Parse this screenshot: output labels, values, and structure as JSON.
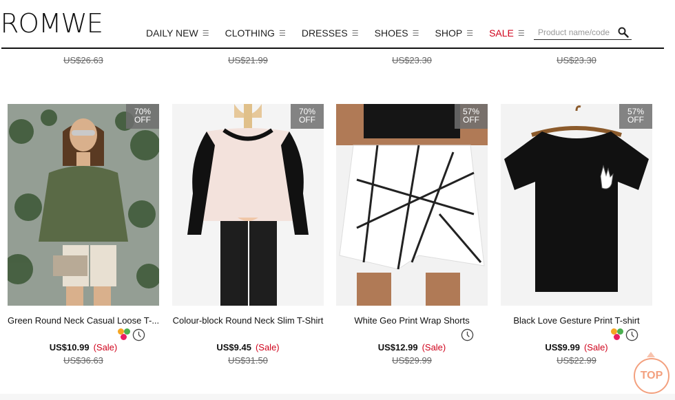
{
  "header": {
    "logo": "ROMWE",
    "nav": [
      {
        "label": "DAILY NEW",
        "icon": "menu-icon"
      },
      {
        "label": "CLOTHING",
        "icon": "menu-icon"
      },
      {
        "label": "DRESSES",
        "icon": "menu-icon"
      },
      {
        "label": "SHOES",
        "icon": "menu-icon"
      },
      {
        "label": "SHOP",
        "icon": "menu-icon"
      },
      {
        "label": "SALE",
        "icon": "menu-icon",
        "color": "#d0021b"
      }
    ],
    "search": {
      "placeholder": "Product name/code",
      "icon": "search-icon"
    }
  },
  "previous_row_prices": [
    "US$26.63",
    "US$21.99",
    "US$23.30",
    "US$23.30"
  ],
  "products": [
    {
      "title": "Green Round Neck Casual Loose T-...",
      "discount": "70%",
      "discount_label": "OFF",
      "price": "US$10.99",
      "sale": "(Sale)",
      "original": "US$36.63",
      "has_colors": true,
      "icon": "clock-icon"
    },
    {
      "title": "Colour-block Round Neck Slim T-Shirt",
      "discount": "70%",
      "discount_label": "OFF",
      "price": "US$9.45",
      "sale": "(Sale)",
      "original": "US$31.50",
      "has_colors": false,
      "icon": "clock-icon"
    },
    {
      "title": "White Geo Print Wrap Shorts",
      "discount": "57%",
      "discount_label": "OFF",
      "price": "US$12.99",
      "sale": "(Sale)",
      "original": "US$29.99",
      "has_colors": false,
      "icon": "clock-icon"
    },
    {
      "title": "Black Love Gesture Print T-shirt",
      "discount": "57%",
      "discount_label": "OFF",
      "price": "US$9.99",
      "sale": "(Sale)",
      "original": "US$22.99",
      "has_colors": true,
      "icon": "clock-icon"
    }
  ],
  "back_to_top": "TOP",
  "colors": {
    "accent": "#d0021b",
    "top_button": "#f3a07e"
  }
}
